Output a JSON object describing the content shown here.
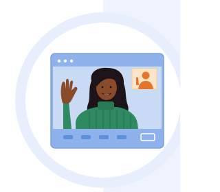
{
  "illustration": {
    "subject": "video-call",
    "colors": {
      "background_panel": "#eef3fd",
      "outer_ring": "#e8effc",
      "window_frame": "#8eb3ec",
      "window_border": "#7aa2e0",
      "video_area": "#c9daf5",
      "toolbar_button": "#5e8fdc",
      "skin": "#8a4b2b",
      "hair": "#1c1418",
      "sweater": "#2f8a62",
      "thumbnail_bg": "#fde6c8",
      "thumbnail_person": "#e4752e"
    },
    "window_controls": [
      "dot",
      "dot",
      "dot"
    ],
    "toolbar_buttons": [
      "button",
      "button",
      "button",
      "button",
      "button-outline"
    ]
  }
}
